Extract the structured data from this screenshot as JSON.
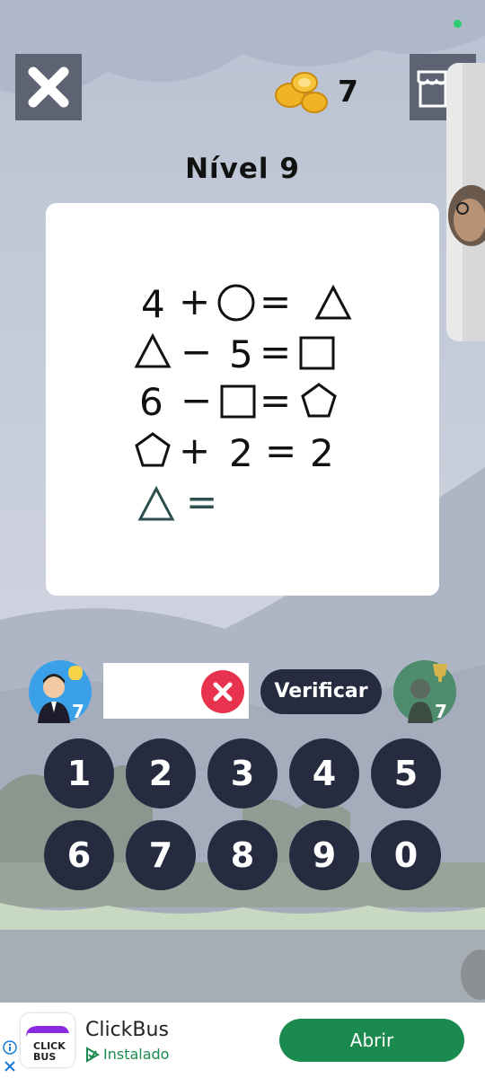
{
  "header": {
    "close_icon": "close-x-icon",
    "coin_icon": "coins-icon",
    "coin_count": "7",
    "shop_icon": "shop-icon"
  },
  "level": {
    "title": "Nível 9"
  },
  "puzzle": {
    "lines": [
      {
        "left": "4 +",
        "shape1": "circle",
        "mid": "=",
        "shape2": "triangle"
      },
      {
        "left": "− 5 =",
        "shape1": "triangle",
        "shape2": "square"
      },
      {
        "left": "6 −",
        "shape1": "square",
        "mid": "=",
        "shape2": "pentagon"
      },
      {
        "left": "+ 2 = 2",
        "shape1": "pentagon"
      },
      {
        "left": "=",
        "shape1": "triangle"
      }
    ],
    "text": {
      "l1a": "4",
      "l1b": "+",
      "l1c": "=",
      "l2a": "−",
      "l2b": "5",
      "l2c": "=",
      "l3a": "6",
      "l3b": "−",
      "l3c": "=",
      "l4a": "+",
      "l4b": "2",
      "l4c": "=",
      "l4d": "2",
      "l5a": "="
    }
  },
  "hint": {
    "icon": "hint-avatar-icon",
    "count": "7"
  },
  "answer": {
    "value": "",
    "clear_icon": "clear-x-icon"
  },
  "verify_label": "Verificar",
  "trophy": {
    "icon": "trophy-avatar-icon",
    "count": "7"
  },
  "keypad": [
    "1",
    "2",
    "3",
    "4",
    "5",
    "6",
    "7",
    "8",
    "9",
    "0"
  ],
  "ad": {
    "logo_text_1": "CLICK",
    "logo_text_2": "BUS",
    "name": "ClickBus",
    "status": "Instalado",
    "button": "Abrir",
    "info_icon": "info-icon",
    "close_icon": "close-icon"
  },
  "colors": {
    "key_bg": "#262b40",
    "clear_red": "#e8334f",
    "ad_green": "#1a8a4e"
  }
}
